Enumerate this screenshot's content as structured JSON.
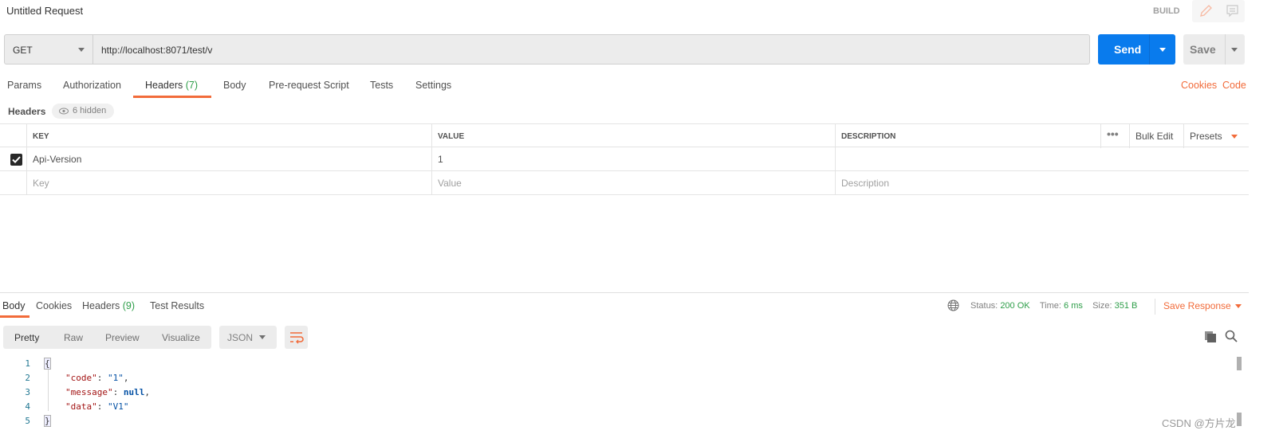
{
  "title": "Untitled Request",
  "build": "BUILD",
  "request": {
    "method": "GET",
    "url": "http://localhost:8071/test/v",
    "send": "Send",
    "save": "Save"
  },
  "tabs": [
    {
      "label": "Params"
    },
    {
      "label": "Authorization"
    },
    {
      "label": "Headers",
      "count": "(7)",
      "active": true
    },
    {
      "label": "Body"
    },
    {
      "label": "Pre-request Script"
    },
    {
      "label": "Tests"
    },
    {
      "label": "Settings"
    }
  ],
  "links": {
    "cookies": "Cookies",
    "code": "Code"
  },
  "headers_label": "Headers",
  "hidden_badge": "6 hidden",
  "table": {
    "columns": [
      "KEY",
      "VALUE",
      "DESCRIPTION"
    ],
    "bulk_edit": "Bulk Edit",
    "presets": "Presets",
    "rows": [
      {
        "checked": true,
        "key": "Api-Version",
        "value": "1",
        "description": ""
      }
    ],
    "placeholders": {
      "key": "Key",
      "value": "Value",
      "description": "Description"
    }
  },
  "response": {
    "tabs": [
      "Body",
      "Cookies",
      "Headers",
      "Test Results"
    ],
    "headers_count": "(9)",
    "status_label": "Status:",
    "status": "200 OK",
    "time_label": "Time:",
    "time": "6 ms",
    "size_label": "Size:",
    "size": "351 B",
    "save_response": "Save Response",
    "views": [
      "Pretty",
      "Raw",
      "Preview",
      "Visualize"
    ],
    "format": "JSON",
    "lines": [
      "1",
      "2",
      "3",
      "4",
      "5"
    ],
    "code": {
      "open": "{",
      "code_key": "\"code\"",
      "code_val": "\"1\"",
      "message_key": "\"message\"",
      "message_val": "null",
      "data_key": "\"data\"",
      "data_val": "\"V1\"",
      "close": "}"
    }
  },
  "watermark": "CSDN @方片龙",
  "colors": {
    "accent": "#f26b3a",
    "send": "#097bed",
    "success": "#2e9e49"
  }
}
